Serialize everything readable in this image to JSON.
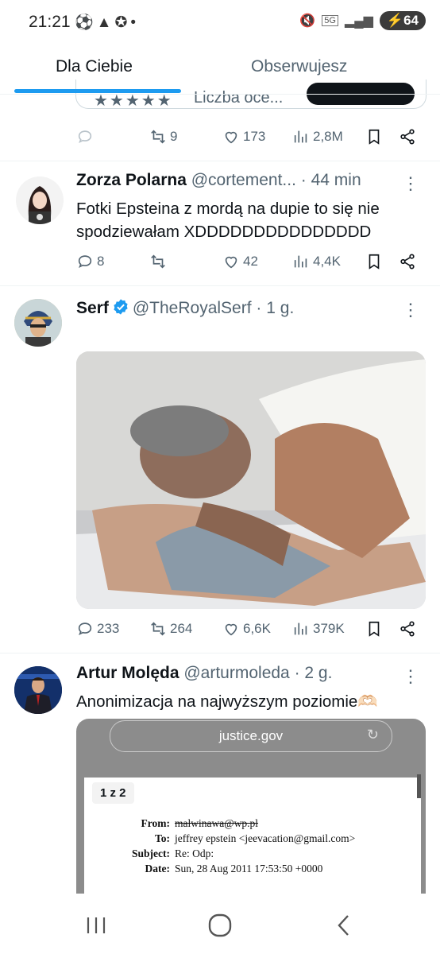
{
  "status_bar": {
    "time": "21:21",
    "left_icons": [
      "football-icon",
      "warning-icon",
      "star-badge-icon",
      "dot-icon"
    ],
    "network": "5G",
    "battery": "64"
  },
  "tabs": [
    {
      "label": "Dla Ciebie",
      "active": true
    },
    {
      "label": "Obserwujesz",
      "active": false
    }
  ],
  "partial_card": {
    "stars": "★★★★★",
    "rating_text": "Liczba oce..."
  },
  "top_actions": {
    "reply": "",
    "retweet": "9",
    "like": "173",
    "views": "2,8M"
  },
  "tweets": [
    {
      "name": "Zorza Polarna",
      "handle": "@cortement...",
      "time": "· 44 min",
      "text": "Fotki Epsteina z mordą na dupie to się nie spodziewałam XDDDDDDDDDDDDDDD",
      "reply": "8",
      "retweet": "",
      "like": "42",
      "views": "4,4K"
    },
    {
      "name": "Serf",
      "handle": "@TheRoyalSerf",
      "time": "· 1 g.",
      "text": "",
      "reply": "233",
      "retweet": "264",
      "like": "6,6K",
      "views": "379K"
    },
    {
      "name": "Artur Molęda",
      "handle": "@arturmoleda",
      "time": "· 2 g.",
      "text": "Anonimizacja na najwyższym poziomie🫶🏻"
    }
  ],
  "embedded_doc": {
    "url": "justice.gov",
    "page_badge": "1 z 2",
    "from_label": "From:",
    "from_value": "malwinawa@wp.pl",
    "to_label": "To:",
    "to_value": "jeffrey epstein <jeevacation@gmail.com>",
    "subject_label": "Subject:",
    "subject_value": "Re: Odp:",
    "date_label": "Date:",
    "date_value": "Sun, 28 Aug 2011 17:53:50 +0000"
  },
  "colors": {
    "accent": "#1d9bf0",
    "text": "#0f1419",
    "muted": "#536471",
    "verified": "#1d9bf0"
  }
}
